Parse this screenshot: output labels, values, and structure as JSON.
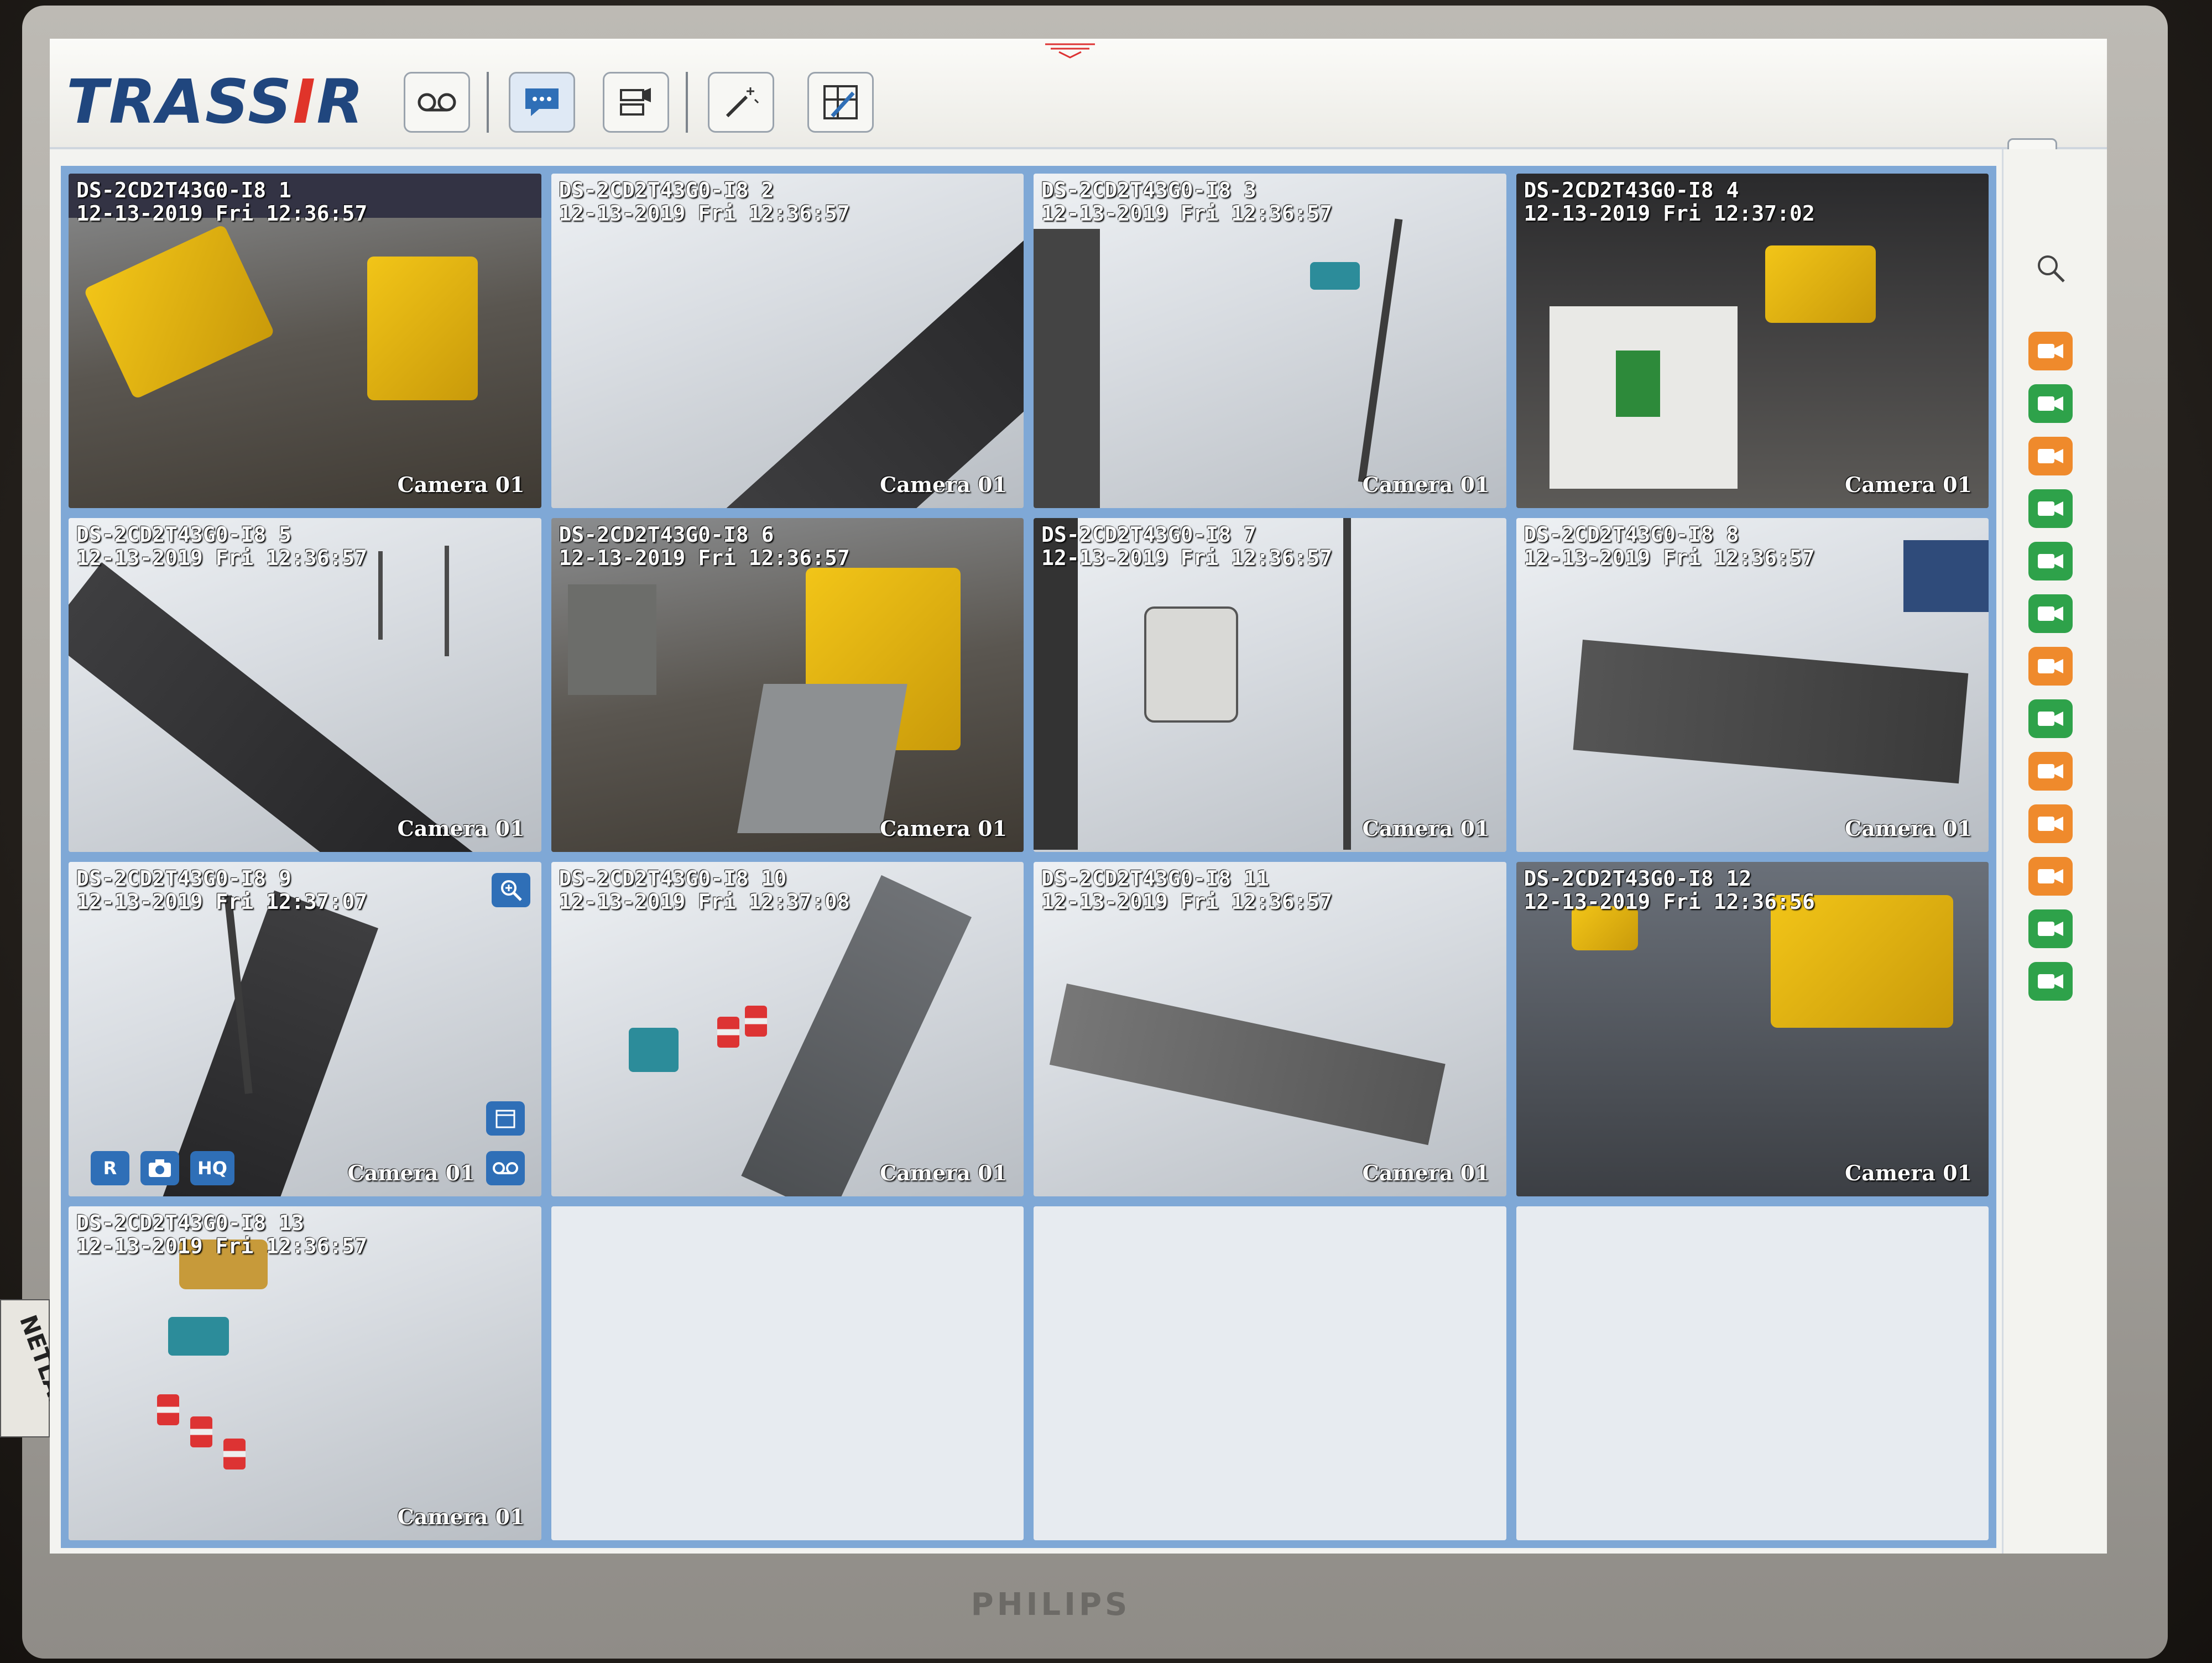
{
  "app": {
    "logo_text": "TRASSIR"
  },
  "monitor": {
    "brand": "PHILIPS",
    "sticker": "NETLAN"
  },
  "toolbar": {
    "buttons": [
      {
        "name": "archive-button",
        "icon": "tape-icon"
      },
      {
        "name": "chat-button",
        "icon": "speech-bubble-icon"
      },
      {
        "name": "layout-button",
        "icon": "camera-layout-icon"
      },
      {
        "name": "wizard-button",
        "icon": "magic-wand-icon"
      },
      {
        "name": "settings-button",
        "icon": "tools-icon"
      }
    ]
  },
  "cameras": [
    {
      "title": "DS-2CD2T43G0-I8 1",
      "time": "12-13-2019 Fri 12:36:57",
      "label": "Camera 01"
    },
    {
      "title": "DS-2CD2T43G0-I8 2",
      "time": "12-13-2019 Fri 12:36:57",
      "label": "Camera 01"
    },
    {
      "title": "DS-2CD2T43G0-I8 3",
      "time": "12-13-2019 Fri 12:36:57",
      "label": "Camera 01"
    },
    {
      "title": "DS-2CD2T43G0-I8 4",
      "time": "12-13-2019 Fri 12:37:02",
      "label": "Camera 01"
    },
    {
      "title": "DS-2CD2T43G0-I8 5",
      "time": "12-13-2019 Fri 12:36:57",
      "label": "Camera 01"
    },
    {
      "title": "DS-2CD2T43G0-I8 6",
      "time": "12-13-2019 Fri 12:36:57",
      "label": "Camera 01"
    },
    {
      "title": "DS-2CD2T43G0-I8 7",
      "time": "12-13-2019 Fri 12:36:57",
      "label": "Camera 01"
    },
    {
      "title": "DS-2CD2T43G0-I8 8",
      "time": "12-13-2019 Fri 12:36:57",
      "label": "Camera 01"
    },
    {
      "title": "DS-2CD2T43G0-I8 9",
      "time": "12-13-2019 Fri 12:37:07",
      "label": "Camera 01"
    },
    {
      "title": "DS-2CD2T43G0-I8 10",
      "time": "12-13-2019 Fri 12:37:08",
      "label": "Camera 01"
    },
    {
      "title": "DS-2CD2T43G0-I8 11",
      "time": "12-13-2019 Fri 12:36:57",
      "label": "Camera 01"
    },
    {
      "title": "DS-2CD2T43G0-I8 12",
      "time": "12-13-2019 Fri 12:36:56",
      "label": "Camera 01"
    },
    {
      "title": "DS-2CD2T43G0-I8 13",
      "time": "12-13-2019 Fri 12:36:57",
      "label": "Camera 01"
    }
  ],
  "tile_overlay": {
    "record": "R",
    "hq": "HQ"
  },
  "camera_list": {
    "colors": {
      "orange": "#ef8a2c",
      "green": "#2ea24a"
    },
    "statuses": [
      "orange",
      "green",
      "orange",
      "green",
      "green",
      "green",
      "orange",
      "green",
      "orange",
      "orange",
      "orange",
      "green",
      "green"
    ]
  }
}
